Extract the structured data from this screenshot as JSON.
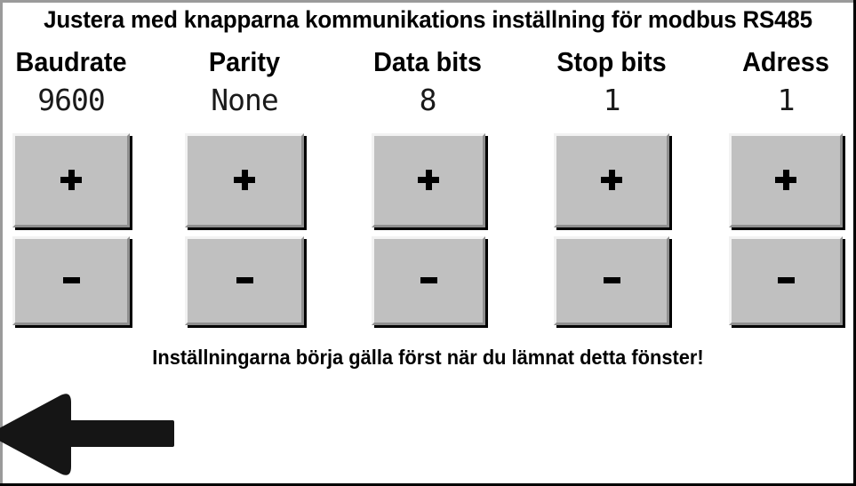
{
  "window": {
    "title": "Justera med knapparna kommunikations inställning för modbus RS485",
    "footer_note": "Inställningarna börja gälla först när du lämnat detta fönster!",
    "background_color": "#ffffff",
    "button_face_color": "#c0c0c0",
    "text_color": "#000000"
  },
  "settings": [
    {
      "label": "Baudrate",
      "value": "9600",
      "increment_label": "+",
      "decrement_label": "-"
    },
    {
      "label": "Parity",
      "value": "None",
      "increment_label": "+",
      "decrement_label": "-"
    },
    {
      "label": "Data bits",
      "value": "8",
      "increment_label": "+",
      "decrement_label": "-"
    },
    {
      "label": "Stop bits",
      "value": "1",
      "increment_label": "+",
      "decrement_label": "-"
    },
    {
      "label": "Adress",
      "value": "1",
      "increment_label": "+",
      "decrement_label": "-"
    }
  ],
  "navigation": {
    "back_icon": "back-arrow-icon"
  }
}
